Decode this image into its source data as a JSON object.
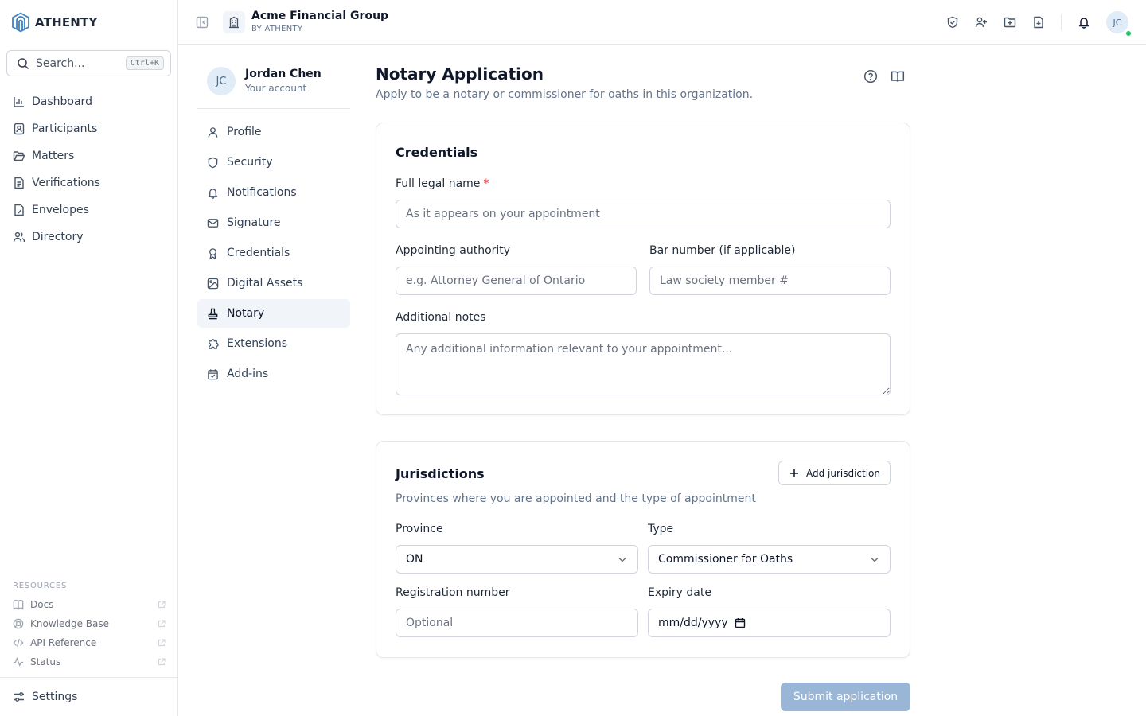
{
  "brand": {
    "name": "ATHENTY",
    "icon": "athenty-logo-icon"
  },
  "search": {
    "placeholder": "Search...",
    "shortcut": "Ctrl+K"
  },
  "sidebar": {
    "items": [
      {
        "label": "Dashboard",
        "icon": "dashboard-icon"
      },
      {
        "label": "Participants",
        "icon": "participants-icon"
      },
      {
        "label": "Matters",
        "icon": "folder-icon"
      },
      {
        "label": "Verifications",
        "icon": "document-icon"
      },
      {
        "label": "Envelopes",
        "icon": "envelope-icon"
      },
      {
        "label": "Directory",
        "icon": "directory-icon"
      }
    ],
    "resources_title": "RESOURCES",
    "resources": [
      {
        "label": "Docs",
        "icon": "book-icon"
      },
      {
        "label": "Knowledge Base",
        "icon": "lifebuoy-icon"
      },
      {
        "label": "API Reference",
        "icon": "code-icon"
      },
      {
        "label": "Status",
        "icon": "activity-icon"
      }
    ],
    "settings_label": "Settings"
  },
  "header": {
    "org_name": "Acme Financial Group",
    "org_sub": "BY ATHENTY",
    "avatar_initials": "JC"
  },
  "account": {
    "initials": "JC",
    "name": "Jordan Chen",
    "sub": "Your account"
  },
  "settings_nav": {
    "items": [
      {
        "label": "Profile",
        "icon": "user-icon"
      },
      {
        "label": "Security",
        "icon": "shield-icon"
      },
      {
        "label": "Notifications",
        "icon": "bell-icon"
      },
      {
        "label": "Signature",
        "icon": "mail-icon"
      },
      {
        "label": "Credentials",
        "icon": "award-icon"
      },
      {
        "label": "Digital Assets",
        "icon": "image-icon"
      },
      {
        "label": "Notary",
        "icon": "stamp-icon",
        "active": true
      },
      {
        "label": "Extensions",
        "icon": "puzzle-icon"
      },
      {
        "label": "Add-ins",
        "icon": "calendar-check-icon"
      }
    ]
  },
  "page": {
    "title": "Notary Application",
    "description": "Apply to be a notary or commissioner for oaths in this organization."
  },
  "credentials": {
    "title": "Credentials",
    "full_name_label": "Full legal name",
    "required_mark": "*",
    "full_name_placeholder": "As it appears on your appointment",
    "authority_label": "Appointing authority",
    "authority_placeholder": "e.g. Attorney General of Ontario",
    "bar_label": "Bar number (if applicable)",
    "bar_placeholder": "Law society member #",
    "notes_label": "Additional notes",
    "notes_placeholder": "Any additional information relevant to your appointment..."
  },
  "jurisdictions": {
    "title": "Jurisdictions",
    "add_label": "Add jurisdiction",
    "description": "Provinces where you are appointed and the type of appointment",
    "province_label": "Province",
    "province_value": "ON",
    "type_label": "Type",
    "type_value": "Commissioner for Oaths",
    "registration_label": "Registration number",
    "registration_placeholder": "Optional",
    "expiry_label": "Expiry date",
    "expiry_placeholder": "mm/dd/yyyy"
  },
  "submit_label": "Submit application",
  "colors": {
    "accent": "#0f172a",
    "submit_disabled": "#9ab6d6",
    "required": "#dc2626",
    "online": "#22c55e"
  }
}
